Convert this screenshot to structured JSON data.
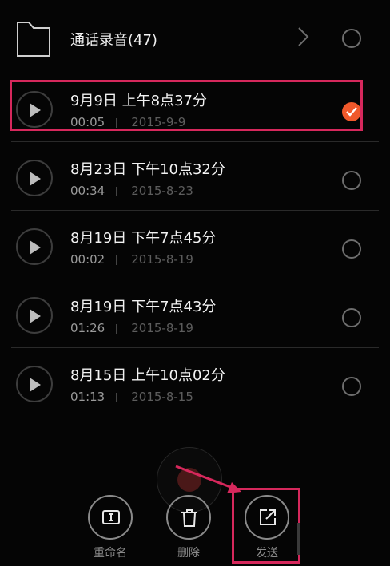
{
  "folder": {
    "name": "通话录音(47)"
  },
  "recordings": [
    {
      "title": "9月9日 上午8点37分",
      "duration": "00:05",
      "date": "2015-9-9",
      "selected": true
    },
    {
      "title": "8月23日 下午10点32分",
      "duration": "00:34",
      "date": "2015-8-23",
      "selected": false
    },
    {
      "title": "8月19日 下午7点45分",
      "duration": "00:02",
      "date": "2015-8-19",
      "selected": false
    },
    {
      "title": "8月19日 下午7点43分",
      "duration": "01:26",
      "date": "2015-8-19",
      "selected": false
    },
    {
      "title": "8月15日 上午10点02分",
      "duration": "01:13",
      "date": "2015-8-15",
      "selected": false
    }
  ],
  "actions": {
    "rename": "重命名",
    "delete": "删除",
    "send": "发送"
  },
  "colors": {
    "accent_check": "#f0592b",
    "highlight": "#d6285c",
    "record_button": "#4a1818"
  }
}
